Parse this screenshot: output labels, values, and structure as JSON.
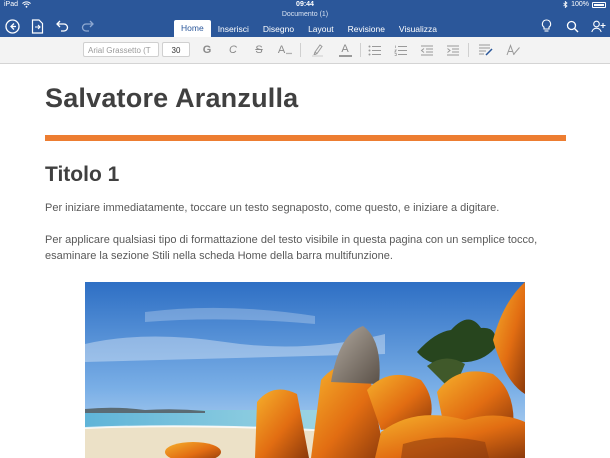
{
  "status": {
    "device": "iPad",
    "time": "09:44",
    "battery": "100%"
  },
  "document": {
    "title": "Documento (1)"
  },
  "tabs": [
    {
      "label": "Home",
      "active": true
    },
    {
      "label": "Inserisci"
    },
    {
      "label": "Disegno"
    },
    {
      "label": "Layout"
    },
    {
      "label": "Revisione"
    },
    {
      "label": "Visualizza"
    }
  ],
  "toolbar": {
    "font_placeholder": "Arial Grassetto (T",
    "font_size": "30",
    "bold": "G",
    "italic": "C",
    "strike": "S",
    "font_size_menu": "A",
    "font_color": "A"
  },
  "content": {
    "heading": "Salvatore Aranzulla",
    "title1": "Titolo 1",
    "paragraph1": "Per iniziare immediatamente, toccare un testo segnaposto, come questo, e iniziare a digitare.",
    "paragraph2": "Per applicare qualsiasi tipo di formattazione del testo visibile in questa pagina con un semplice tocco, esaminare la sezione Stili nella scheda Home della barra multifunzione."
  },
  "colors": {
    "brand": "#2b579a",
    "accent": "#ed7d31"
  }
}
